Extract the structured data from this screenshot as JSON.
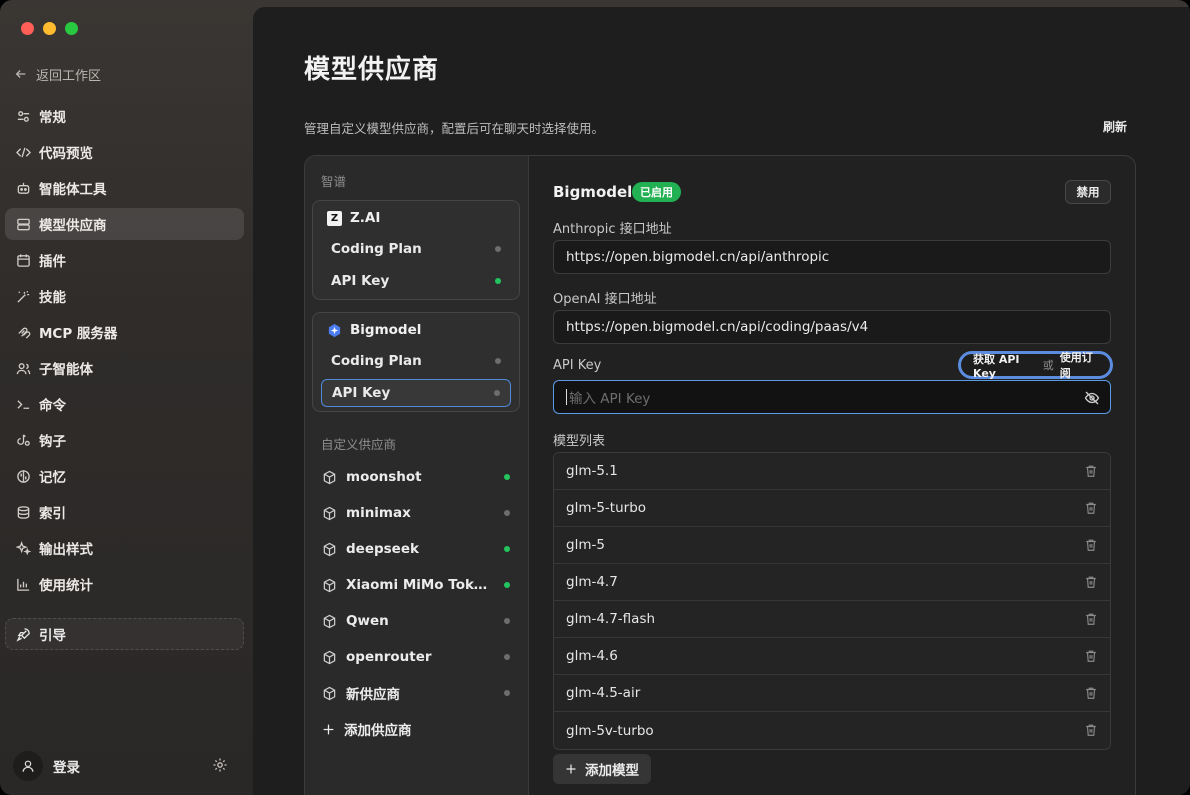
{
  "sidebar": {
    "back_label": "返回工作区",
    "items": [
      {
        "label": "常规",
        "icon": "sliders-icon"
      },
      {
        "label": "代码预览",
        "icon": "code-icon"
      },
      {
        "label": "智能体工具",
        "icon": "robot-icon"
      },
      {
        "label": "模型供应商",
        "icon": "server-icon",
        "active": true
      },
      {
        "label": "插件",
        "icon": "calendar-icon"
      },
      {
        "label": "技能",
        "icon": "magic-wand-icon"
      },
      {
        "label": "MCP 服务器",
        "icon": "mcp-icon"
      },
      {
        "label": "子智能体",
        "icon": "users-icon"
      },
      {
        "label": "命令",
        "icon": "terminal-icon"
      },
      {
        "label": "钩子",
        "icon": "hook-icon"
      },
      {
        "label": "记忆",
        "icon": "brain-icon"
      },
      {
        "label": "索引",
        "icon": "database-icon"
      },
      {
        "label": "输出样式",
        "icon": "sparkles-icon"
      },
      {
        "label": "使用统计",
        "icon": "bar-chart-icon"
      }
    ],
    "guide_label": "引导",
    "user_label": "登录"
  },
  "main": {
    "title": "模型供应商",
    "description": "管理自定义模型供应商，配置后可在聊天时选择使用。",
    "refresh_label": "刷新"
  },
  "providers": {
    "builtin_label": "智谱",
    "groups": [
      {
        "name": "Z.AI",
        "logo": "zai-logo-icon",
        "items": [
          {
            "label": "Coding Plan",
            "enabled": false
          },
          {
            "label": "API Key",
            "enabled": true
          }
        ]
      },
      {
        "name": "Bigmodel",
        "logo": "bigmodel-logo-icon",
        "items": [
          {
            "label": "Coding Plan",
            "enabled": false
          },
          {
            "label": "API Key",
            "enabled": false,
            "selected": true
          }
        ]
      }
    ],
    "custom_label": "自定义供应商",
    "custom": [
      {
        "label": "moonshot",
        "enabled": true
      },
      {
        "label": "minimax",
        "enabled": false
      },
      {
        "label": "deepseek",
        "enabled": true
      },
      {
        "label": "Xiaomi MiMo Token ...",
        "enabled": true
      },
      {
        "label": "Qwen",
        "enabled": false
      },
      {
        "label": "openrouter",
        "enabled": false
      },
      {
        "label": "新供应商",
        "enabled": false
      }
    ],
    "add_label": "添加供应商"
  },
  "detail": {
    "name": "Bigmodel",
    "status_badge": "已启用",
    "disable_label": "禁用",
    "anthropic_label": "Anthropic 接口地址",
    "anthropic_value": "https://open.bigmodel.cn/api/anthropic",
    "openai_label": "OpenAI 接口地址",
    "openai_value": "https://open.bigmodel.cn/api/coding/paas/v4",
    "api_key_label": "API Key",
    "api_key_placeholder": "输入 API Key",
    "get_key_label": "获取 API Key",
    "or_label": "或",
    "subscription_label": "使用订阅",
    "models_label": "模型列表",
    "models": [
      "glm-5.1",
      "glm-5-turbo",
      "glm-5",
      "glm-4.7",
      "glm-4.7-flash",
      "glm-4.6",
      "glm-4.5-air",
      "glm-5v-turbo"
    ],
    "add_model_label": "添加模型"
  },
  "colors": {
    "accent_blue": "#5b9ae6",
    "enabled_green": "#22c55e",
    "badge_green": "#21b152"
  }
}
